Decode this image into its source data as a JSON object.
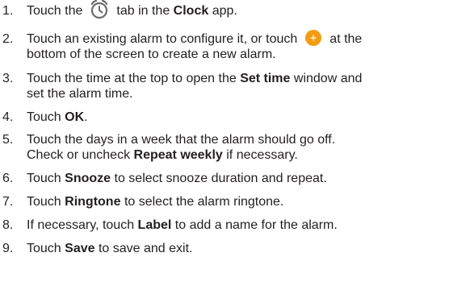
{
  "steps": [
    {
      "num": "1.",
      "a": "Touch the",
      "b": "tab in the",
      "bold": "Clock",
      "c": "app."
    },
    {
      "num": "2.",
      "a": "Touch an existing alarm to configure it, or touch",
      "b": "at the",
      "line2": "bottom of the screen to create a new alarm."
    },
    {
      "num": "3.",
      "a": "Touch the time at the top to open the",
      "bold": "Set time",
      "b": "window and",
      "line2": "set the alarm time."
    },
    {
      "num": "4.",
      "a": "Touch",
      "bold": "OK",
      "b": "."
    },
    {
      "num": "5.",
      "a": "Touch the days in a week that the alarm should go off.",
      "line2a": "Check or uncheck",
      "line2bold": "Repeat weekly",
      "line2b": "if necessary."
    },
    {
      "num": "6.",
      "a": "Touch",
      "bold": "Snooze",
      "b": "to select snooze duration and repeat."
    },
    {
      "num": "7.",
      "a": "Touch",
      "bold": "Ringtone",
      "b": "to select the alarm ringtone."
    },
    {
      "num": "8.",
      "a": "If necessary, touch",
      "bold": "Label",
      "b": "to add a name for the alarm."
    },
    {
      "num": "9.",
      "a": "Touch",
      "bold": "Save",
      "b": "to save and exit."
    }
  ],
  "icons": {
    "clock": "alarm-clock-icon",
    "add": "add-alarm-icon",
    "add_color": "#f39c12"
  },
  "colors": {
    "text": "#231f20",
    "icon_stroke": "#6b6b6b"
  }
}
